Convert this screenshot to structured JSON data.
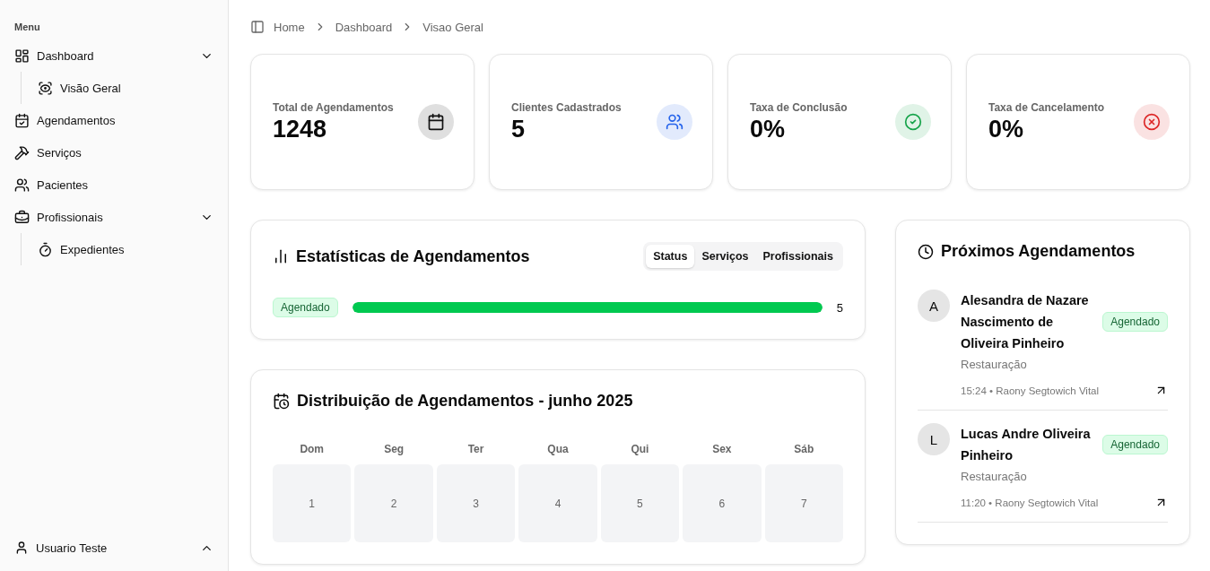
{
  "sidebar": {
    "heading": "Menu",
    "items": [
      {
        "label": "Dashboard",
        "kind": "dashboard",
        "expanded": true,
        "children": [
          {
            "label": "Visão Geral",
            "kind": "eye"
          }
        ]
      },
      {
        "label": "Agendamentos",
        "kind": "calendar"
      },
      {
        "label": "Serviços",
        "kind": "hammer"
      },
      {
        "label": "Pacientes",
        "kind": "users"
      },
      {
        "label": "Profissionais",
        "kind": "briefcase",
        "expanded": true,
        "children": [
          {
            "label": "Expedientes",
            "kind": "timer"
          }
        ]
      }
    ],
    "user": {
      "name": "Usuario Teste"
    }
  },
  "breadcrumb": [
    "Home",
    "Dashboard",
    "Visao Geral"
  ],
  "stats": [
    {
      "label": "Total de Agendamentos",
      "value": "1248",
      "kind": "calendar",
      "color": "#111111"
    },
    {
      "label": "Clientes Cadastrados",
      "value": "5",
      "kind": "users",
      "color": "#2563eb"
    },
    {
      "label": "Taxa de Conclusão",
      "value": "0%",
      "kind": "check",
      "color": "#16a34a"
    },
    {
      "label": "Taxa de Cancelamento",
      "value": "0%",
      "kind": "cancel",
      "color": "#dc2626"
    }
  ],
  "statistics": {
    "title": "Estatísticas de Agendamentos",
    "tabs": [
      {
        "label": "Status",
        "selected": true
      },
      {
        "label": "Serviços",
        "selected": false
      },
      {
        "label": "Profissionais",
        "selected": false
      }
    ],
    "bars": [
      {
        "label": "Agendado",
        "level": 1,
        "count": "5"
      }
    ]
  },
  "calendar": {
    "title": "Distribuição de Agendamentos - junho 2025",
    "weekdays": [
      "Dom",
      "Seg",
      "Ter",
      "Qua",
      "Qui",
      "Sex",
      "Sáb"
    ],
    "days": [
      "1",
      "2",
      "3",
      "4",
      "5",
      "6",
      "7"
    ]
  },
  "upcoming": {
    "title": "Próximos Agendamentos",
    "items": [
      {
        "initial": "A",
        "name": "Alesandra de Nazare Nascimento de Oliveira Pinheiro",
        "status": "Agendado",
        "service": "Restauração",
        "meta": "15:24 • Raony Segtowich Vital"
      },
      {
        "initial": "L",
        "name": "Lucas Andre Oliveira Pinheiro",
        "status": "Agendado",
        "service": "Restauração",
        "meta": "11:20 • Raony Segtowich Vital"
      }
    ]
  }
}
